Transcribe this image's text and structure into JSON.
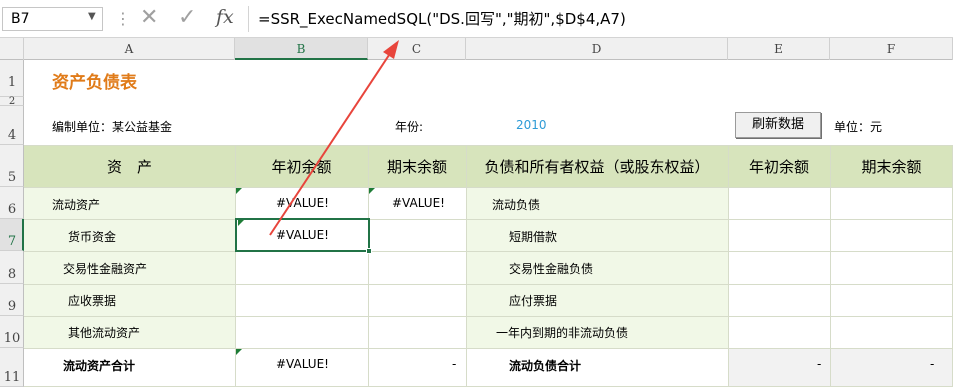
{
  "formula_bar": {
    "name_box": "B7",
    "cancel_icon": "✕",
    "enter_icon": "✓",
    "fx_label": "fx",
    "formula": "=SSR_ExecNamedSQL(\"DS.回写\",\"期初\",$D$4,A7)"
  },
  "columns": [
    "A",
    "B",
    "C",
    "D",
    "E",
    "F"
  ],
  "rows": [
    "1",
    "2",
    "4",
    "5",
    "6",
    "7",
    "8",
    "9",
    "10",
    "11"
  ],
  "sheet": {
    "title": "资产负债表",
    "org_label": "编制单位：某公益基金",
    "year_label": "年份:",
    "year_value": "2010",
    "refresh_button": "刷新数据",
    "unit_label": "单位：元",
    "headers": [
      "资　产",
      "年初余额",
      "期末余额",
      "负债和所有者权益（或股东权益）",
      "年初余额",
      "期末余额"
    ],
    "assets": [
      "流动资产",
      "货币资金",
      "交易性金融资产",
      "应收票据",
      "其他流动资产",
      "流动资产合计"
    ],
    "liabilities": [
      "流动负债",
      "短期借款",
      "交易性金融负债",
      "应付票据",
      "一年内到期的非流动负债",
      "流动负债合计"
    ],
    "b_values": [
      "#VALUE!",
      "#VALUE!",
      "",
      "",
      "",
      "#VALUE!"
    ],
    "c_values": [
      "#VALUE!",
      "",
      "",
      "",
      "",
      "-"
    ],
    "e_total": "-",
    "f_total": "-"
  },
  "colors": {
    "title": "#e07b19",
    "header_fill": "#d7e4bc",
    "body_fill": "#f1f8e7",
    "year_value": "#2e9bd6",
    "arrow": "#e8453c",
    "selection": "#217346"
  }
}
